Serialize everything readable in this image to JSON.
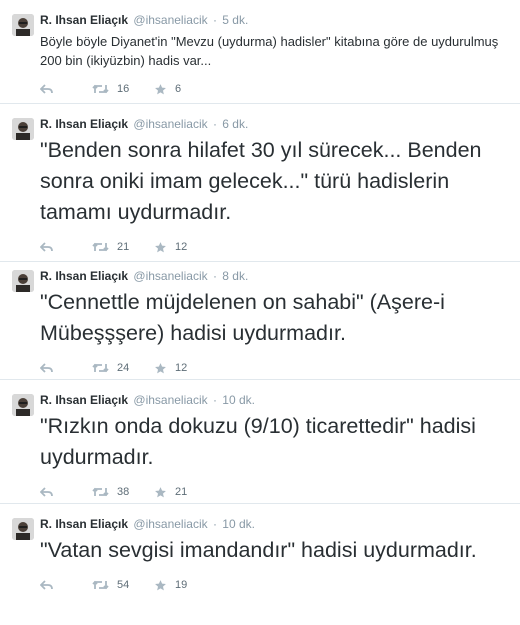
{
  "tweets": [
    {
      "fullname": "R. Ihsan Eliaçık",
      "username": "@ihsaneliacik",
      "separator": "·",
      "time": "5 dk.",
      "text": "Böyle böyle Diyanet'in \"Mevzu (uydurma) hadisler\" kitabına göre de uydurulmuş 200 bin (ikiyüzbin) hadis var...",
      "retweets": "16",
      "favorites": "6"
    },
    {
      "fullname": "R. Ihsan Eliaçık",
      "username": "@ihsaneliacik",
      "separator": "·",
      "time": "6 dk.",
      "text": "\"Benden sonra hilafet 30 yıl sürecek... Benden sonra oniki imam gelecek...\" türü hadislerin tamamı uydurmadır.",
      "retweets": "21",
      "favorites": "12"
    },
    {
      "fullname": "R. Ihsan Eliaçık",
      "username": "@ihsaneliacik",
      "separator": "·",
      "time": "8 dk.",
      "text": "\"Cennettle müjdelenen on sahabi\" (Aşere-i Mübeşşşere) hadisi uydurmadır.",
      "retweets": "24",
      "favorites": "12"
    },
    {
      "fullname": "R. Ihsan Eliaçık",
      "username": "@ihsaneliacik",
      "separator": "·",
      "time": "10 dk.",
      "text": "\"Rızkın onda dokuzu (9/10) ticarettedir\" hadisi uydurmadır.",
      "retweets": "38",
      "favorites": "21"
    },
    {
      "fullname": "R. Ihsan Eliaçık",
      "username": "@ihsaneliacik",
      "separator": "·",
      "time": "10 dk.",
      "text": "\"Vatan sevgisi imandandır\" hadisi uydurmadır.",
      "retweets": "54",
      "favorites": "19"
    }
  ],
  "icons": {
    "avatar": "avatar",
    "reply": "reply-icon",
    "retweet": "retweet-icon",
    "favorite": "star-icon"
  },
  "colors": {
    "text": "#292f33",
    "meta": "#8899a6",
    "divider": "#e1e8ed"
  }
}
